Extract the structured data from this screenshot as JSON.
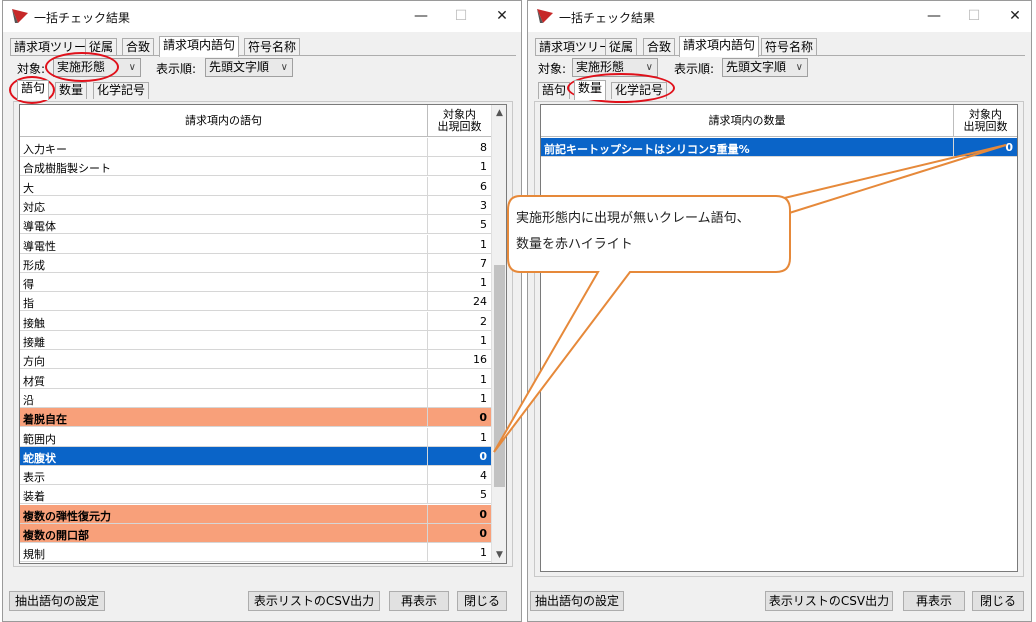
{
  "window_title": "一括チェック結果",
  "titlebar_buttons": {
    "minimize": "—",
    "maximize": "☐",
    "close": "✕"
  },
  "tabs": [
    "請求項ツリー",
    "従属",
    "合致",
    "請求項内語句",
    "符号名称"
  ],
  "target_label": "対象:",
  "target_value": "実施形態",
  "order_label": "表示順:",
  "order_value": "先頭文字順",
  "left_subtabs": [
    "語句",
    "数量",
    "化学記号"
  ],
  "right_subtabs": [
    "語句",
    "数量",
    "化学記号"
  ],
  "left_table": {
    "header_term": "請求項内の語句",
    "header_count_line1": "対象内",
    "header_count_line2": "出現回数",
    "rows": [
      {
        "term": "入力キー",
        "count": "8",
        "state": ""
      },
      {
        "term": "合成樹脂製シート",
        "count": "1",
        "state": ""
      },
      {
        "term": "大",
        "count": "6",
        "state": ""
      },
      {
        "term": "対応",
        "count": "3",
        "state": ""
      },
      {
        "term": "導電体",
        "count": "5",
        "state": ""
      },
      {
        "term": "導電性",
        "count": "1",
        "state": ""
      },
      {
        "term": "形成",
        "count": "7",
        "state": ""
      },
      {
        "term": "得",
        "count": "1",
        "state": ""
      },
      {
        "term": "指",
        "count": "24",
        "state": ""
      },
      {
        "term": "接触",
        "count": "2",
        "state": ""
      },
      {
        "term": "接離",
        "count": "1",
        "state": ""
      },
      {
        "term": "方向",
        "count": "16",
        "state": ""
      },
      {
        "term": "材質",
        "count": "1",
        "state": ""
      },
      {
        "term": "沿",
        "count": "1",
        "state": ""
      },
      {
        "term": "着脱自在",
        "count": "0",
        "state": "hl"
      },
      {
        "term": "範囲内",
        "count": "1",
        "state": ""
      },
      {
        "term": "蛇腹状",
        "count": "0",
        "state": "sel"
      },
      {
        "term": "表示",
        "count": "4",
        "state": ""
      },
      {
        "term": "装着",
        "count": "5",
        "state": ""
      },
      {
        "term": "複数の弾性復元力",
        "count": "0",
        "state": "hl"
      },
      {
        "term": "複数の開口部",
        "count": "0",
        "state": "hl"
      },
      {
        "term": "規制",
        "count": "1",
        "state": ""
      }
    ]
  },
  "right_table": {
    "header_term": "請求項内の数量",
    "header_count_line1": "対象内",
    "header_count_line2": "出現回数",
    "rows": [
      {
        "term": "前記キートップシートはシリコン5重量%",
        "count": "0",
        "state": "sel"
      }
    ]
  },
  "buttons": {
    "extract_settings": "抽出語句の設定",
    "csv_output": "表示リストのCSV出力",
    "redisplay": "再表示",
    "close": "閉じる"
  },
  "callout_line1": "実施形態内に出現が無いクレーム語句、",
  "callout_line2": "数量を赤ハイライト",
  "colors": {
    "highlight": "#f8a07a",
    "selected": "#0a64c8",
    "annotation_red": "#e0101a",
    "callout_orange": "#e6893a"
  }
}
